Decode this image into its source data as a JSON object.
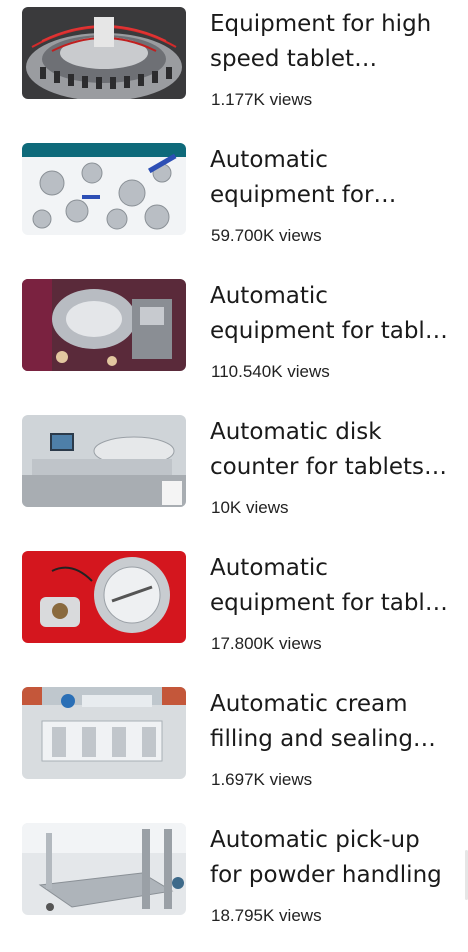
{
  "videos": [
    {
      "title": "Equipment for high speed tablet production",
      "views": "1.177K views",
      "thumb_icon": "rotary-tablet-press-thumbnail"
    },
    {
      "title": "Automatic equipment for stainless steel fittings",
      "views": "59.700K views",
      "thumb_icon": "sanitary-valves-thumbnail"
    },
    {
      "title": "Automatic equipment for tablet coating",
      "views": "110.540K views",
      "thumb_icon": "coating-machine-thumbnail"
    },
    {
      "title": "Automatic disk counter for tablets and capsules",
      "views": "10K views",
      "thumb_icon": "disk-counter-thumbnail"
    },
    {
      "title": "Automatic equipment for tablet polishing",
      "views": "17.800K views",
      "thumb_icon": "polishing-machine-thumbnail"
    },
    {
      "title": "Automatic cream filling and sealing machine",
      "views": "1.697K views",
      "thumb_icon": "cream-filling-machine-thumbnail"
    },
    {
      "title": "Automatic pick-up for powder handling",
      "views": "18.795K views",
      "thumb_icon": "powder-cart-thumbnail"
    }
  ]
}
